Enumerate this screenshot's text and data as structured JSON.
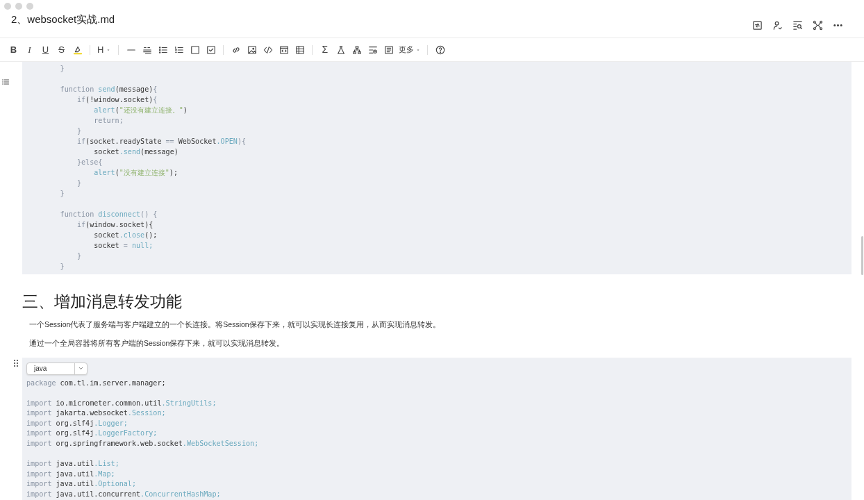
{
  "window": {
    "title": "2、websocket实战.md"
  },
  "toolbar": {
    "format_buttons": [
      "B",
      "I",
      "U",
      "S"
    ],
    "heading_button": "H",
    "formula_button": "Σ",
    "more_button": "更多"
  },
  "code_blocks": [
    {
      "lines": [
        {
          "kind": "code",
          "segments": [
            {
              "text": "        }",
              "kind": "punct"
            }
          ]
        },
        {
          "kind": "blank"
        },
        {
          "kind": "code",
          "segments": [
            {
              "text": "        function",
              "kind": "keyword"
            },
            {
              "text": " send",
              "kind": "name"
            },
            {
              "text": "(message)",
              "kind": "plain"
            },
            {
              "text": "{",
              "kind": "punct"
            }
          ]
        },
        {
          "kind": "code",
          "segments": [
            {
              "text": "            if",
              "kind": "keyword"
            },
            {
              "text": "(!window.socket)",
              "kind": "plain"
            },
            {
              "text": "{",
              "kind": "punct"
            }
          ]
        },
        {
          "kind": "code",
          "segments": [
            {
              "text": "                alert",
              "kind": "name"
            },
            {
              "text": "(",
              "kind": "plain"
            },
            {
              "text": "\"还没有建立连接。\"",
              "kind": "string"
            },
            {
              "text": ")",
              "kind": "plain"
            }
          ]
        },
        {
          "kind": "code",
          "segments": [
            {
              "text": "                return;",
              "kind": "keyword"
            }
          ]
        },
        {
          "kind": "code",
          "segments": [
            {
              "text": "            }",
              "kind": "punct"
            }
          ]
        },
        {
          "kind": "code",
          "segments": [
            {
              "text": "            if",
              "kind": "keyword"
            },
            {
              "text": "(socket.readyState ",
              "kind": "plain"
            },
            {
              "text": "==",
              "kind": "punct"
            },
            {
              "text": " WebSocket",
              "kind": "plain"
            },
            {
              "text": ".OPEN",
              "kind": "name"
            },
            {
              "text": "){",
              "kind": "punct"
            }
          ]
        },
        {
          "kind": "code",
          "segments": [
            {
              "text": "                socket",
              "kind": "plain"
            },
            {
              "text": ".send",
              "kind": "name"
            },
            {
              "text": "(message)",
              "kind": "plain"
            }
          ]
        },
        {
          "kind": "code",
          "segments": [
            {
              "text": "            }",
              "kind": "punct"
            },
            {
              "text": "else",
              "kind": "keyword"
            },
            {
              "text": "{",
              "kind": "punct"
            }
          ]
        },
        {
          "kind": "code",
          "segments": [
            {
              "text": "                alert",
              "kind": "name"
            },
            {
              "text": "(",
              "kind": "plain"
            },
            {
              "text": "\"没有建立连接\"",
              "kind": "string"
            },
            {
              "text": ");",
              "kind": "plain"
            }
          ]
        },
        {
          "kind": "code",
          "segments": [
            {
              "text": "            }",
              "kind": "punct"
            }
          ]
        },
        {
          "kind": "code",
          "segments": [
            {
              "text": "        }",
              "kind": "punct"
            }
          ]
        },
        {
          "kind": "blank"
        },
        {
          "kind": "code",
          "segments": [
            {
              "text": "        function",
              "kind": "keyword"
            },
            {
              "text": " disconnect",
              "kind": "name"
            },
            {
              "text": "() {",
              "kind": "punct"
            }
          ]
        },
        {
          "kind": "code",
          "segments": [
            {
              "text": "            if",
              "kind": "keyword"
            },
            {
              "text": "(window.socket){",
              "kind": "plain"
            }
          ]
        },
        {
          "kind": "code",
          "segments": [
            {
              "text": "                socket",
              "kind": "plain"
            },
            {
              "text": ".close",
              "kind": "name"
            },
            {
              "text": "();",
              "kind": "plain"
            }
          ]
        },
        {
          "kind": "code",
          "segments": [
            {
              "text": "                socket ",
              "kind": "plain"
            },
            {
              "text": "=",
              "kind": "punct"
            },
            {
              "text": " null;",
              "kind": "name"
            }
          ]
        },
        {
          "kind": "code",
          "segments": [
            {
              "text": "            }",
              "kind": "punct"
            }
          ]
        },
        {
          "kind": "code",
          "segments": [
            {
              "text": "        }",
              "kind": "punct"
            }
          ]
        }
      ]
    },
    {
      "language": "java",
      "lines": [
        {
          "kind": "code",
          "segments": [
            {
              "text": "package",
              "kind": "keyword"
            },
            {
              "text": " com.tl.im.server.manager;",
              "kind": "plain"
            }
          ]
        },
        {
          "kind": "blank"
        },
        {
          "kind": "code",
          "segments": [
            {
              "text": "import",
              "kind": "keyword"
            },
            {
              "text": " io.micrometer.common.util",
              "kind": "plain"
            },
            {
              "text": ".StringUtils;",
              "kind": "name"
            }
          ]
        },
        {
          "kind": "code",
          "segments": [
            {
              "text": "import",
              "kind": "keyword"
            },
            {
              "text": " jakarta.websocket",
              "kind": "plain"
            },
            {
              "text": ".Session;",
              "kind": "name"
            }
          ]
        },
        {
          "kind": "code",
          "segments": [
            {
              "text": "import",
              "kind": "keyword"
            },
            {
              "text": " org.slf4j",
              "kind": "plain"
            },
            {
              "text": ".Logger;",
              "kind": "name"
            }
          ]
        },
        {
          "kind": "code",
          "segments": [
            {
              "text": "import",
              "kind": "keyword"
            },
            {
              "text": " org.slf4j",
              "kind": "plain"
            },
            {
              "text": ".LoggerFactory;",
              "kind": "name"
            }
          ]
        },
        {
          "kind": "code",
          "segments": [
            {
              "text": "import",
              "kind": "keyword"
            },
            {
              "text": " org.springframework.web.socket",
              "kind": "plain"
            },
            {
              "text": ".WebSocketSession;",
              "kind": "name"
            }
          ]
        },
        {
          "kind": "blank"
        },
        {
          "kind": "code",
          "segments": [
            {
              "text": "import",
              "kind": "keyword"
            },
            {
              "text": " java.util",
              "kind": "plain"
            },
            {
              "text": ".List;",
              "kind": "name"
            }
          ]
        },
        {
          "kind": "code",
          "segments": [
            {
              "text": "import",
              "kind": "keyword"
            },
            {
              "text": " java.util",
              "kind": "plain"
            },
            {
              "text": ".Map;",
              "kind": "name"
            }
          ]
        },
        {
          "kind": "code",
          "segments": [
            {
              "text": "import",
              "kind": "keyword"
            },
            {
              "text": " java.util",
              "kind": "plain"
            },
            {
              "text": ".Optional;",
              "kind": "name"
            }
          ]
        },
        {
          "kind": "code",
          "segments": [
            {
              "text": "import",
              "kind": "keyword"
            },
            {
              "text": " java.util.concurrent",
              "kind": "plain"
            },
            {
              "text": ".ConcurrentHashMap;",
              "kind": "name"
            }
          ]
        }
      ]
    }
  ],
  "section": {
    "heading": "三、增加消息转发功能",
    "paragraphs": [
      "一个Session代表了服务端与客户端建立的一个长连接。将Session保存下来，就可以实现长连接复用，从而实现消息转发。",
      "通过一个全局容器将所有客户端的Session保存下来，就可以实现消息转发。"
    ]
  }
}
